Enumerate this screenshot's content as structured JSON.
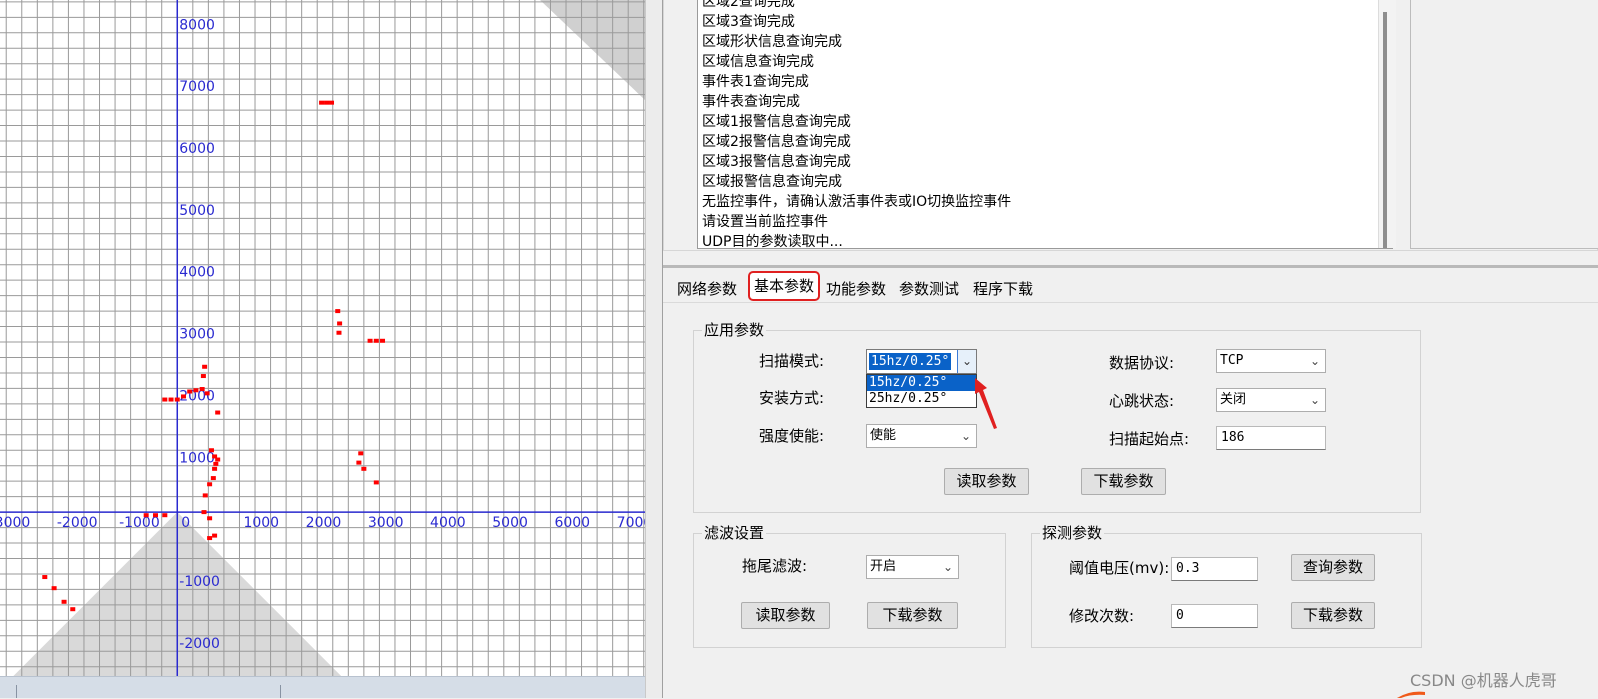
{
  "chart_data": {
    "type": "scatter",
    "x_ticks": [
      -3000,
      -2000,
      -1000,
      0,
      1000,
      2000,
      3000,
      4000,
      5000,
      6000,
      7000
    ],
    "x_tick_labels": [
      "3000",
      "-2000",
      "-1000",
      "0",
      "1000",
      "2000",
      "3000",
      "4000",
      "5000",
      "6000",
      "7000"
    ],
    "y_ticks": [
      8000,
      7000,
      6000,
      5000,
      4000,
      3000,
      2000,
      1000,
      -1000,
      -2000
    ],
    "y_tick_labels": [
      "8000",
      "7000",
      "6000",
      "5000",
      "4000",
      "3000",
      "2000",
      "1000",
      "-1000",
      "-2000"
    ],
    "xlim": [
      -2850,
      7520
    ],
    "ylim": [
      -2650,
      8280
    ],
    "grid": true,
    "fov_color": "#d9d9d9",
    "point_color": "#ff0000",
    "points": [
      [
        2320,
        6620
      ],
      [
        2400,
        6620
      ],
      [
        2480,
        6620
      ],
      [
        2580,
        3250
      ],
      [
        2610,
        3050
      ],
      [
        2600,
        2900
      ],
      [
        3100,
        2770
      ],
      [
        3200,
        2770
      ],
      [
        3300,
        2770
      ],
      [
        -200,
        1820
      ],
      [
        -100,
        1820
      ],
      [
        0,
        1820
      ],
      [
        100,
        1870
      ],
      [
        200,
        1950
      ],
      [
        300,
        1970
      ],
      [
        400,
        1990
      ],
      [
        480,
        1920
      ],
      [
        420,
        2200
      ],
      [
        440,
        2350
      ],
      [
        650,
        1610
      ],
      [
        550,
        1000
      ],
      [
        600,
        900
      ],
      [
        650,
        850
      ],
      [
        620,
        780
      ],
      [
        600,
        700
      ],
      [
        580,
        550
      ],
      [
        520,
        450
      ],
      [
        2950,
        950
      ],
      [
        2920,
        800
      ],
      [
        3000,
        700
      ],
      [
        3200,
        480
      ],
      [
        450,
        270
      ],
      [
        430,
        0
      ],
      [
        520,
        -100
      ],
      [
        600,
        -380
      ],
      [
        520,
        -420
      ],
      [
        -500,
        -50
      ],
      [
        -350,
        -50
      ],
      [
        -200,
        -50
      ],
      [
        -2130,
        -1050
      ],
      [
        -1980,
        -1230
      ],
      [
        -1820,
        -1450
      ],
      [
        -1680,
        -1570
      ]
    ]
  },
  "log": {
    "lines": [
      "区域2查询完成",
      "区域3查询完成",
      "区域形状信息查询完成",
      "区域信息查询完成",
      "事件表1查询完成",
      "事件表查询完成",
      "区域1报警信息查询完成",
      "区域2报警信息查询完成",
      "区域3报警信息查询完成",
      "区域报警信息查询完成",
      "无监控事件，请确认激活事件表或IO切换监控事件",
      "请设置当前监控事件",
      "UDP目的参数读取中..."
    ]
  },
  "tabs": [
    "网络参数",
    "基本参数",
    "功能参数",
    "参数测试",
    "程序下载"
  ],
  "app_params": {
    "title": "应用参数",
    "scan_mode_label": "扫描模式:",
    "scan_mode_value": "15hz/0.25°",
    "scan_mode_options": [
      "15hz/0.25°",
      "25hz/0.25°"
    ],
    "install_label": "安装方式:",
    "intensity_label": "强度使能:",
    "intensity_value": "使能",
    "protocol_label": "数据协议:",
    "protocol_value": "TCP",
    "heartbeat_label": "心跳状态:",
    "heartbeat_value": "关闭",
    "scan_start_label": "扫描起始点:",
    "scan_start_value": "186",
    "read_btn": "读取参数",
    "download_btn": "下载参数"
  },
  "filter": {
    "title": "滤波设置",
    "tail_label": "拖尾滤波:",
    "tail_value": "开启",
    "read_btn": "读取参数",
    "download_btn": "下载参数"
  },
  "detect": {
    "title": "探测参数",
    "threshold_label": "阈值电压(mv):",
    "threshold_value": "0.3",
    "modify_label": "修改次数:",
    "modify_value": "0",
    "query_btn": "查询参数",
    "download_btn": "下载参数"
  },
  "watermark": "CSDN @机器人虎哥",
  "colors": {
    "accent_red": "#e02020",
    "selection_blue": "#0a62c8",
    "axis_blue": "#2a2ad0"
  }
}
